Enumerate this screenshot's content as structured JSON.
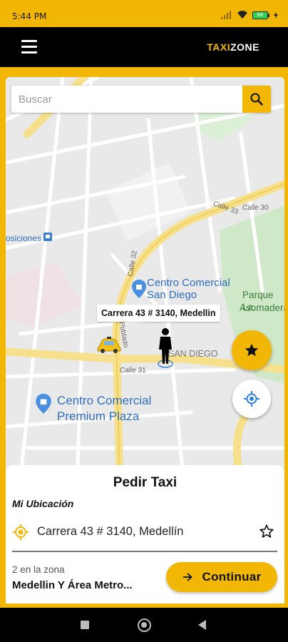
{
  "status_bar": {
    "time": "5:44 PM",
    "battery": "88"
  },
  "app_bar": {
    "brand_part1": "TAXI",
    "brand_part2": "ZONE",
    "menu_icon": "hamburger-menu-icon"
  },
  "search": {
    "placeholder": "Buscar",
    "icon": "search-icon"
  },
  "map": {
    "poi_top_left": "osiciones",
    "poi_cc_san_diego": [
      "Centro Comercial",
      "San Diego"
    ],
    "park_label": [
      "Parque La",
      "Asomadera"
    ],
    "neighborhood": "SAN DIEGO",
    "poi_premium_plaza": [
      "Centro Comercial",
      "Premium Plaza"
    ],
    "streets": [
      "Calle 31",
      "Calle 33",
      "Calle 30",
      "El Poblado",
      "Calle 32"
    ],
    "pin_address": "Carrera 43 # 3140, Medellin"
  },
  "fabs": {
    "favorites_icon": "star-icon",
    "locate_icon": "my-location-icon"
  },
  "card": {
    "title": "Pedir Taxi",
    "subtitle": "Mi Ubicación",
    "address": "Carrera 43 # 3140, Medellín",
    "zone_count": "2 en la zona",
    "zone_name": "Medellin Y Área Metro...",
    "continue_label": "Continuar"
  },
  "colors": {
    "accent": "#f2b705",
    "app_bar": "#000000",
    "map_bg": "#e8e8e8",
    "road_major": "#f6e08c"
  }
}
